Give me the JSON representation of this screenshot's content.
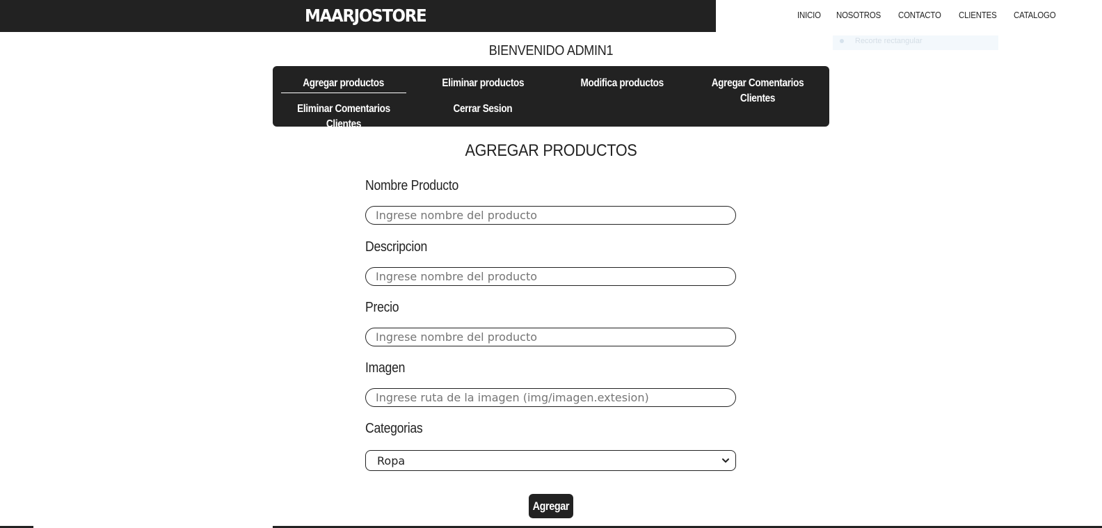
{
  "header": {
    "brand": "MAARJOSTORE",
    "nav": [
      "INICIO",
      "NOSOTROS",
      "CONTACTO",
      "CLIENTES",
      "CATALOGO"
    ]
  },
  "overlay": {
    "ghost_text": "Recorte rectangular"
  },
  "welcome": "BIENVENIDO ADMIN1",
  "admin_menu": {
    "items": [
      "Agregar productos",
      "Eliminar productos",
      "Modifica productos",
      "Agregar Comentarios Clientes",
      "Eliminar Comentarios Clientes",
      "Cerrar Sesion"
    ],
    "active": "Agregar productos"
  },
  "form": {
    "title": "AGREGAR PRODUCTOS",
    "fields": [
      {
        "label": "Nombre Producto",
        "placeholder": "Ingrese nombre del producto"
      },
      {
        "label": "Descripcion",
        "placeholder": "Ingrese nombre del producto"
      },
      {
        "label": "Precio",
        "placeholder": "Ingrese nombre del producto"
      },
      {
        "label": "Imagen",
        "placeholder": "Ingrese ruta de la imagen (img/imagen.extesion)"
      }
    ],
    "category": {
      "label": "Categorias",
      "selected": "Ropa"
    },
    "submit": "Agregar"
  },
  "colors": {
    "dark": "#222222",
    "white": "#ffffff",
    "placeholder": "#757575"
  }
}
